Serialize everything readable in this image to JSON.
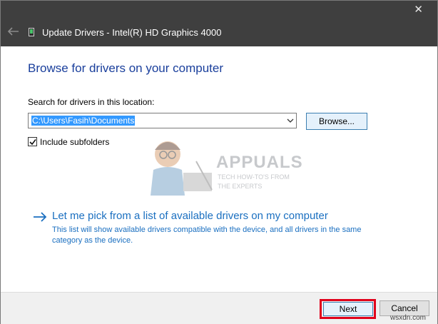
{
  "window": {
    "title": "Update Drivers - Intel(R) HD Graphics 4000",
    "close_glyph": "✕",
    "back_icon": "back-arrow-icon",
    "device_icon": "display-adapter-icon"
  },
  "main": {
    "heading": "Browse for drivers on your computer",
    "search_label": "Search for drivers in this location:",
    "path_value": "C:\\Users\\Fasih\\Documents",
    "browse_label": "Browse...",
    "include_subfolders_label": "Include subfolders",
    "include_subfolders_checked": true
  },
  "watermark": {
    "brand": "APPUALS",
    "tagline_1": "TECH HOW-TO'S FROM",
    "tagline_2": "THE EXPERTS"
  },
  "pick_option": {
    "link_text": "Let me pick from a list of available drivers on my computer",
    "description": "This list will show available drivers compatible with the device, and all drivers in the same category as the device."
  },
  "footer": {
    "next_label": "Next",
    "cancel_label": "Cancel"
  },
  "site_watermark": "wsxdn.com",
  "colors": {
    "titlebar": "#3f3f3f",
    "heading": "#1a3f9c",
    "link": "#1a6fc0",
    "highlight_box": "#e0001b",
    "selection": "#3399ff"
  }
}
